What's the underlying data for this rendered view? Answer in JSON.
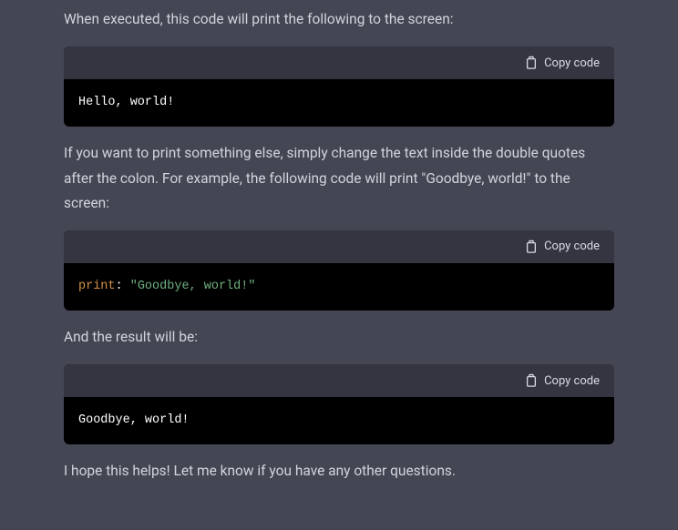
{
  "paragraphs": {
    "p1": "When executed, this code will print the following to the screen:",
    "p2": "If you want to print something else, simply change the text inside the double quotes after the colon. For example, the following code will print \"Goodbye, world!\" to the screen:",
    "p3": "And the result will be:",
    "p4": "I hope this helps! Let me know if you have any other questions."
  },
  "copy_label": "Copy code",
  "code_blocks": {
    "block1": {
      "plain": "Hello, world!"
    },
    "block2": {
      "keyword": "print",
      "colon": ":",
      "space": " ",
      "string": "\"Goodbye, world!\""
    },
    "block3": {
      "plain": "Goodbye, world!"
    }
  }
}
